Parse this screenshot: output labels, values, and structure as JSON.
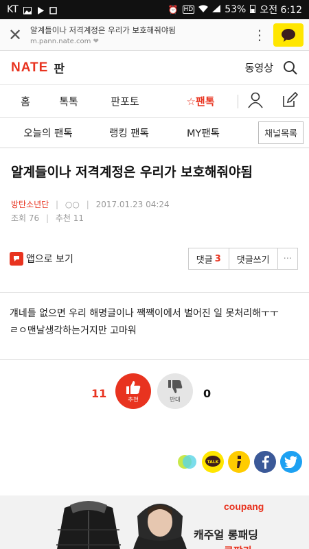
{
  "status": {
    "carrier": "KT",
    "battery": "53%",
    "time": "오전 6:12"
  },
  "browser": {
    "page_title": "알계들이나 저격계정은 우리가 보호해줘야됨",
    "url": "m.pann.nate.com"
  },
  "header": {
    "logo": "NATE",
    "section": "판",
    "video_label": "동영상"
  },
  "main_nav": {
    "items": [
      "홈",
      "톡톡",
      "판포토"
    ],
    "active": "☆팬톡"
  },
  "sub_nav": {
    "items": [
      "오늘의 팬톡",
      "랭킹 팬톡",
      "MY팬톡"
    ],
    "channel_button": "채널목록"
  },
  "post": {
    "title": "알계들이나 저격계정은 우리가 보호해줘야됨",
    "author": "방탄소년단",
    "author_badge": "○○",
    "date": "2017.01.23 04:24",
    "views_label": "조회 76",
    "recommends_label": "추천 11",
    "body_line1": "걔네들 없으면 우리 해명글이나 짹짹이에서 벌어진 일 못처리해ㅜㅜ",
    "body_line2": "ㄹㅇ맨날생각하는거지만 고마워"
  },
  "actions": {
    "app_view": "앱으로 보기",
    "comments_label": "댓글",
    "comments_count": "3",
    "write_comment": "댓글쓰기",
    "more": "···"
  },
  "vote": {
    "up_count": "11",
    "up_label": "추천",
    "down_count": "0",
    "down_label": "반대"
  },
  "share": {
    "kakaotalk_label": "TALK"
  },
  "ad": {
    "brand": "coupang",
    "headline": "캐주얼 롱패딩",
    "sub": "쿠팡가"
  },
  "colors": {
    "accent": "#e8331f",
    "kakao_yellow": "#ffe600",
    "facebook": "#3b5998",
    "twitter": "#1da1f2"
  }
}
